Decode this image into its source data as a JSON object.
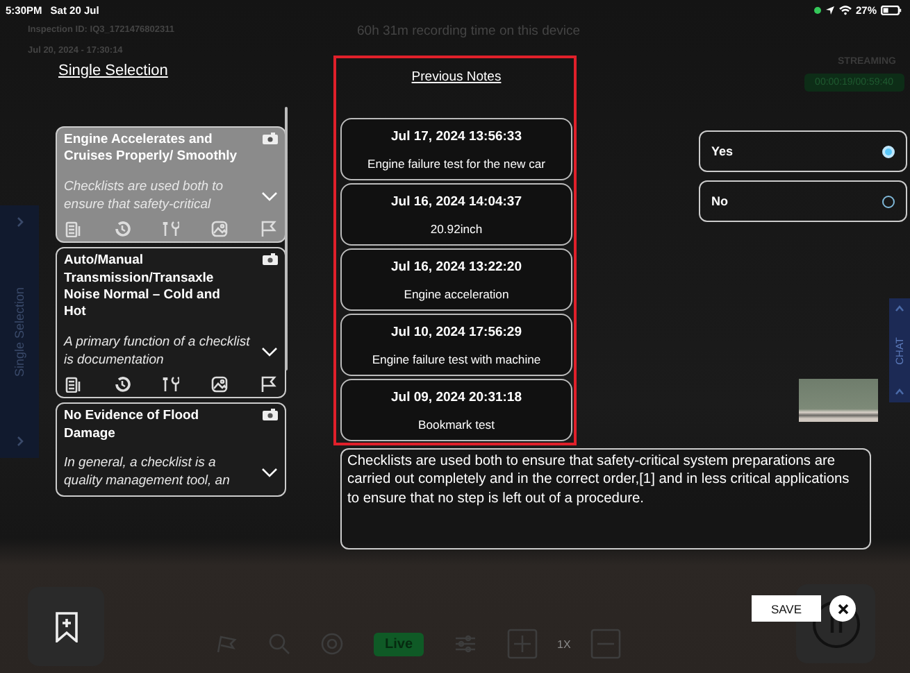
{
  "status_bar": {
    "time": "5:30PM",
    "date": "Sat 20 Jul",
    "battery": "27%"
  },
  "header": {
    "inspection_id": "Inspection ID: IQ3_1721476802311",
    "timestamp": "Jul 20, 2024 - 17:30:14",
    "recording_time": "60h 31m recording time on this device",
    "stream_status": "STREAMING",
    "stream_timer": "00:00:19/00:59:40"
  },
  "side_tabs": {
    "left": "Single Selection",
    "right": "CHAT"
  },
  "checklist": {
    "title": "Single Selection",
    "items": [
      {
        "title": "Engine Accelerates and Cruises Properly/ Smoothly",
        "description": "Checklists are used both to ensure that safety-critical",
        "selected": true
      },
      {
        "title": "Auto/Manual Transmission/Transaxle Noise Normal – Cold and Hot",
        "description": "A primary function of a checklist is documentation",
        "selected": false
      },
      {
        "title": "No Evidence of Flood Damage",
        "description": "In general, a checklist is a quality management tool, an",
        "selected": false
      }
    ]
  },
  "previous_notes": {
    "title": "Previous Notes",
    "notes": [
      {
        "date": "Jul 17, 2024 13:56:33",
        "text": "Engine failure test for the new car"
      },
      {
        "date": "Jul 16, 2024 14:04:37",
        "text": "20.92inch"
      },
      {
        "date": "Jul 16, 2024 13:22:20",
        "text": "Engine acceleration"
      },
      {
        "date": "Jul 10, 2024 17:56:29",
        "text": "Engine failure test with machine"
      },
      {
        "date": "Jul 09, 2024 20:31:18",
        "text": "Bookmark test"
      }
    ]
  },
  "options": [
    {
      "label": "Yes",
      "selected": true
    },
    {
      "label": "No",
      "selected": false
    }
  ],
  "note_text": "Checklists are used both to ensure that safety-critical system preparations are carried out completely and in the correct order,[1] and in less critical applications to ensure that no step is left out of a procedure.",
  "toolbar": {
    "live": {
      "label": "Live",
      "on": true
    },
    "zoom": "1X"
  },
  "save_button": "SAVE"
}
